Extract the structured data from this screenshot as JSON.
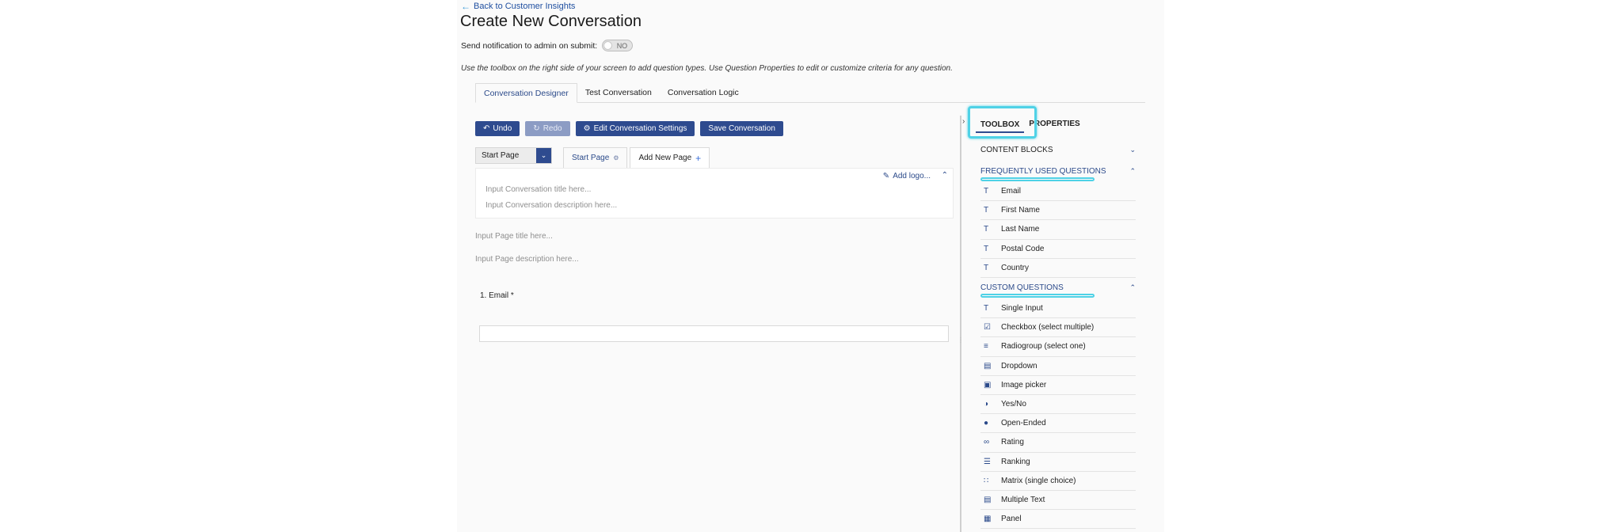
{
  "header": {
    "back_link": "Back to Customer Insights",
    "title": "Create New Conversation",
    "notify_label": "Send notification to admin on submit:",
    "notify_toggle": "NO",
    "hint": "Use the toolbox on the right side of your screen to add question types. Use Question Properties to edit or customize criteria for any question."
  },
  "tabs": [
    {
      "label": "Conversation Designer",
      "active": true
    },
    {
      "label": "Test Conversation",
      "active": false
    },
    {
      "label": "Conversation Logic",
      "active": false
    }
  ],
  "toolbar": {
    "undo": "Undo",
    "redo": "Redo",
    "edit_settings": "Edit Conversation Settings",
    "save": "Save Conversation"
  },
  "pages": {
    "selected": "Start Page",
    "tab_start": "Start Page",
    "tab_add": "Add New Page"
  },
  "conversation": {
    "add_logo": "Add logo...",
    "title_placeholder": "Input Conversation title here...",
    "description_placeholder": "Input Conversation description here...",
    "page_title_placeholder": "Input Page title here...",
    "page_description_placeholder": "Input Page description here..."
  },
  "questions": [
    {
      "label": "1. Email *"
    }
  ],
  "sidebar": {
    "tab_toolbox": "TOOLBOX",
    "tab_properties": "PROPERTIES",
    "content_blocks": "CONTENT BLOCKS",
    "frequently_used": "FREQUENTLY USED QUESTIONS",
    "frequent_items": [
      {
        "label": "Email",
        "icon": "text-icon"
      },
      {
        "label": "First Name",
        "icon": "text-icon"
      },
      {
        "label": "Last Name",
        "icon": "text-icon"
      },
      {
        "label": "Postal Code",
        "icon": "text-icon"
      },
      {
        "label": "Country",
        "icon": "text-icon"
      }
    ],
    "custom_questions": "CUSTOM QUESTIONS",
    "custom_items": [
      {
        "label": "Single Input",
        "icon": "text-icon"
      },
      {
        "label": "Checkbox (select multiple)",
        "icon": "checkbox-icon"
      },
      {
        "label": "Radiogroup (select one)",
        "icon": "radiogroup-icon"
      },
      {
        "label": "Dropdown",
        "icon": "dropdown-icon"
      },
      {
        "label": "Image picker",
        "icon": "image-icon"
      },
      {
        "label": "Yes/No",
        "icon": "yes-no-icon"
      },
      {
        "label": "Open-Ended",
        "icon": "comment-icon"
      },
      {
        "label": "Rating",
        "icon": "rating-icon"
      },
      {
        "label": "Ranking",
        "icon": "ranking-icon"
      },
      {
        "label": "Matrix (single choice)",
        "icon": "matrix-icon"
      },
      {
        "label": "Multiple Text",
        "icon": "multiple-text-icon"
      },
      {
        "label": "Panel",
        "icon": "panel-icon"
      }
    ]
  },
  "colors": {
    "primary": "#2e4b8f",
    "highlight": "#4fd2e6",
    "link": "#1f4fa0"
  }
}
